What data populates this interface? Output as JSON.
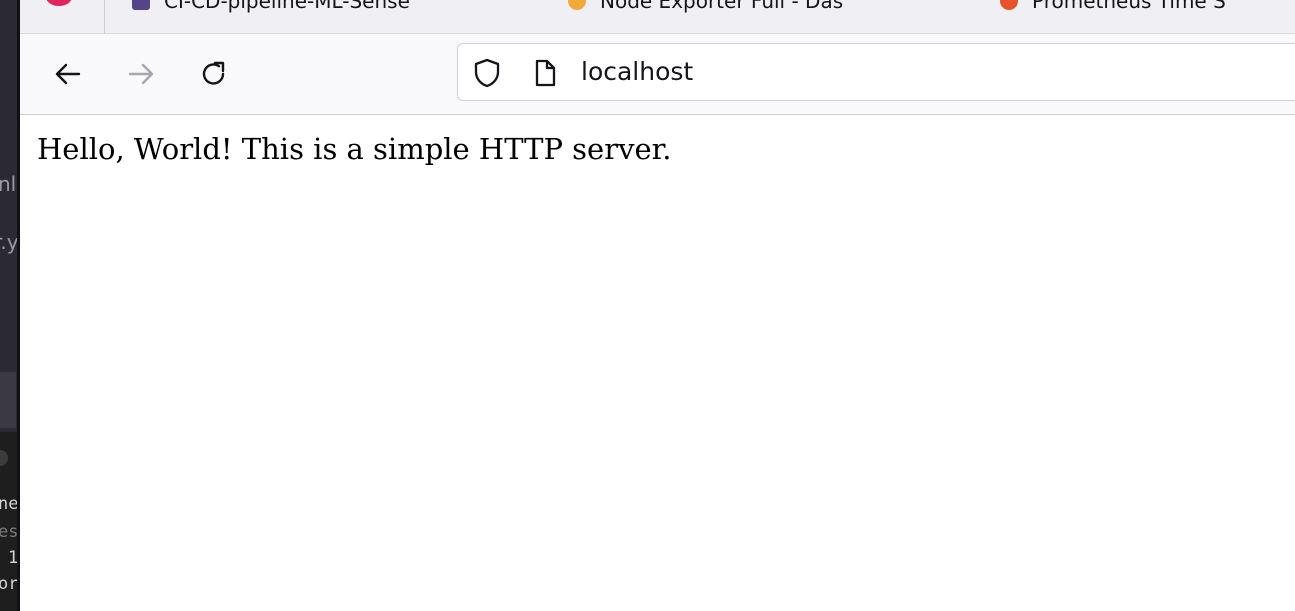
{
  "tabs": [
    {
      "label": "CI-CD-pipeline-ML-Sense",
      "favicon": "gitlab-favicon-icon"
    },
    {
      "label": "Node Exporter Full - Das",
      "favicon": "grafana-favicon-icon"
    },
    {
      "label": "Prometheus Time S",
      "favicon": "prometheus-favicon-icon"
    }
  ],
  "navigation": {
    "back_icon": "back-arrow-icon",
    "forward_icon": "forward-arrow-icon",
    "reload_icon": "reload-icon"
  },
  "urlbar": {
    "value": "localhost",
    "shield_icon": "tracking-protection-shield-icon",
    "page_icon": "page-document-icon"
  },
  "page": {
    "body_text": "Hello, World! This is a simple HTTP server."
  },
  "background_window": {
    "fragments": [
      "nl",
      "r.y",
      "ne",
      "es",
      "1",
      "or"
    ]
  },
  "colors": {
    "tabbar_bg": "#f0f0f4",
    "navbar_bg": "#f9f9fb",
    "close_button": "#e0245e",
    "content_bg": "#ffffff"
  }
}
